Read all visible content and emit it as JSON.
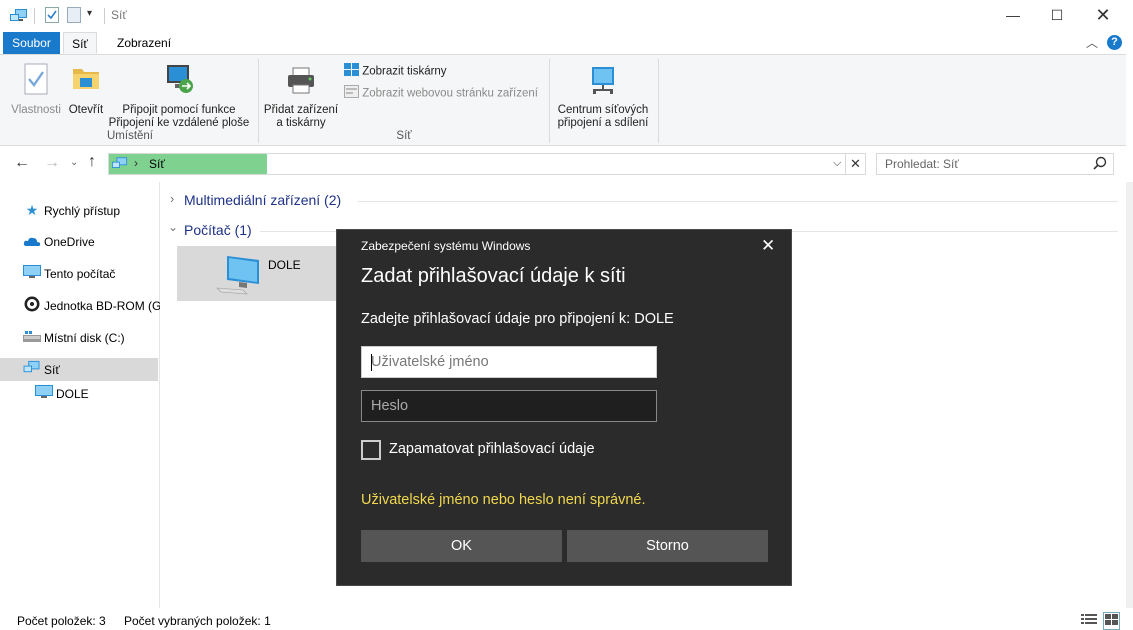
{
  "window": {
    "title": "Síť"
  },
  "ribbon": {
    "tabs": [
      "Soubor",
      "Síť",
      "Zobrazení"
    ],
    "buttons": {
      "properties": "Vlastnosti",
      "open": "Otevřít",
      "remote_line1": "Připojit pomocí funkce",
      "remote_line2": "Připojení ke vzdálené ploše",
      "add_device_line1": "Přidat zařízení",
      "add_device_line2": "a tiskárny",
      "show_printers": "Zobrazit tiskárny",
      "show_device_page": "Zobrazit webovou stránku zařízení",
      "network_center_line1": "Centrum síťových",
      "network_center_line2": "připojení a sdílení"
    },
    "groups": {
      "location": "Umístění",
      "network": "Síť"
    }
  },
  "address": {
    "path": "Síť",
    "separator": "›"
  },
  "search": {
    "placeholder": "Prohledat: Síť"
  },
  "sidebar": {
    "items": [
      {
        "label": "Rychlý přístup",
        "icon": "star-icon"
      },
      {
        "label": "OneDrive",
        "icon": "cloud-icon"
      },
      {
        "label": "Tento počítač",
        "icon": "monitor-icon"
      },
      {
        "label": "Jednotka BD-ROM (G",
        "icon": "disc-icon"
      },
      {
        "label": "Místní disk (C:)",
        "icon": "drive-icon"
      },
      {
        "label": "Síť",
        "icon": "network-icon"
      },
      {
        "label": "DOLE",
        "icon": "monitor-icon"
      }
    ]
  },
  "content": {
    "groups": [
      {
        "label": "Multimediální zařízení (2)",
        "expanded": false
      },
      {
        "label": "Počítač (1)",
        "expanded": true
      }
    ],
    "computer": {
      "name": "DOLE"
    }
  },
  "dialog": {
    "header": "Zabezpečení systému Windows",
    "title": "Zadat přihlašovací údaje k síti",
    "prompt": "Zadejte přihlašovací údaje pro připojení k: DOLE",
    "username_placeholder": "Uživatelské jméno",
    "password_placeholder": "Heslo",
    "remember_label": "Zapamatovat přihlašovací údaje",
    "error": "Uživatelské jméno nebo heslo není správné.",
    "ok": "OK",
    "cancel": "Storno",
    "error_color": "#f1d84e"
  },
  "status": {
    "items_count": "Počet položek: 3",
    "selected_count": "Počet vybraných položek: 1"
  },
  "colors": {
    "accent": "#1979ca",
    "address_highlight": "#7fd18f"
  }
}
